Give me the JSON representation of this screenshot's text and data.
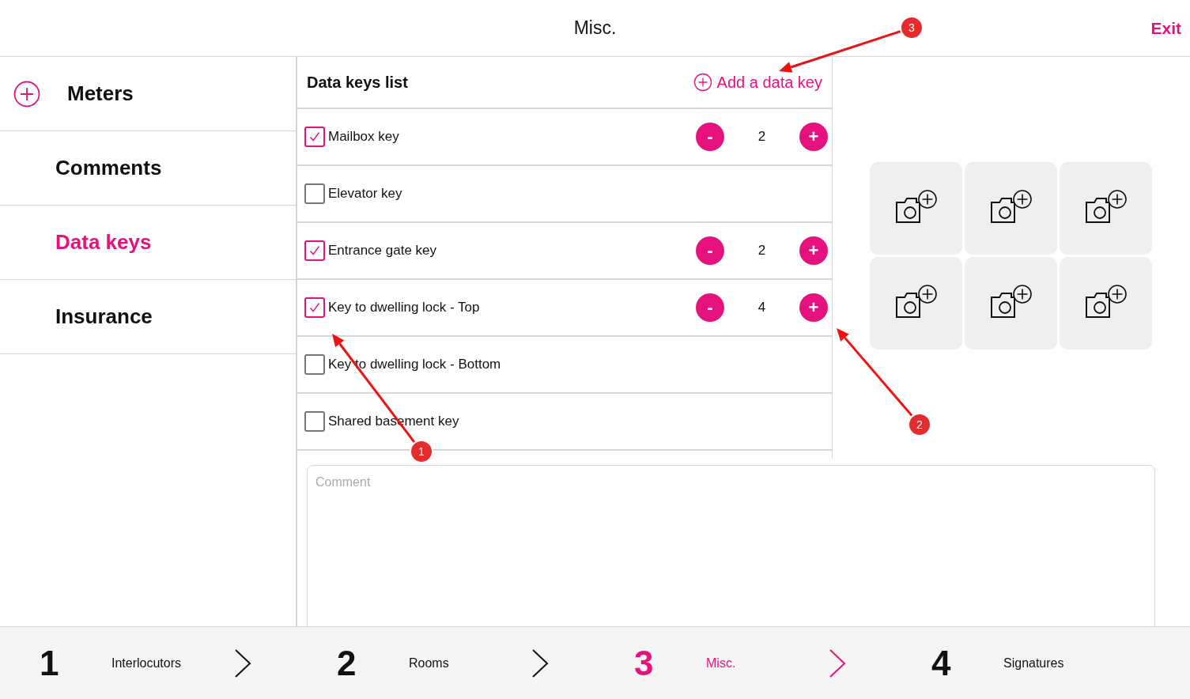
{
  "header": {
    "title": "Misc.",
    "exit": "Exit"
  },
  "sidebar": {
    "items": [
      {
        "label": "Meters",
        "selected": false,
        "kind": "add"
      },
      {
        "label": "Comments",
        "selected": false,
        "kind": "plain"
      },
      {
        "label": "Data keys",
        "selected": true,
        "kind": "plain"
      },
      {
        "label": "Insurance",
        "selected": false,
        "kind": "plain"
      }
    ]
  },
  "data_keys": {
    "title": "Data keys list",
    "add_button": "Add a data key",
    "items": [
      {
        "label": "Mailbox key",
        "checked": true,
        "counter": {
          "decrement": "-",
          "count": "2",
          "increment": "+"
        }
      },
      {
        "label": "Elevator key",
        "checked": false
      },
      {
        "label": "Entrance gate key",
        "checked": true,
        "counter": {
          "decrement": "-",
          "count": "2",
          "increment": "+"
        }
      },
      {
        "label": "Key to dwelling lock - Top",
        "checked": true,
        "counter": {
          "decrement": "-",
          "count": "4",
          "increment": "+"
        }
      },
      {
        "label": "Key to dwelling lock - Bottom",
        "checked": false
      },
      {
        "label": "Shared basement key",
        "checked": false
      }
    ]
  },
  "comment": {
    "placeholder": "Comment"
  },
  "steps": [
    {
      "number": "1",
      "label": "Interlocutors",
      "selected": false
    },
    {
      "number": "2",
      "label": "Rooms",
      "selected": false
    },
    {
      "number": "3",
      "label": "Misc.",
      "selected": true
    },
    {
      "number": "4",
      "label": "Signatures",
      "selected": false
    }
  ],
  "annotations": [
    {
      "label": "1"
    },
    {
      "label": "2"
    },
    {
      "label": "3"
    }
  ]
}
